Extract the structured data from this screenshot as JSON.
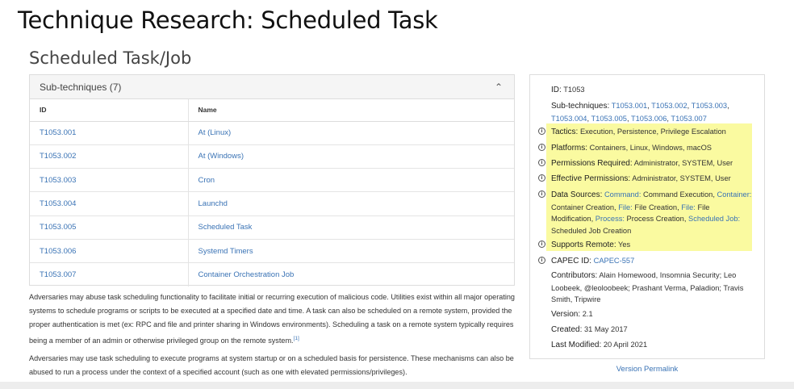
{
  "slide_title": "Technique Research: Scheduled Task",
  "page_heading": "Scheduled Task/Job",
  "subtech": {
    "header": "Sub-techniques (7)",
    "col_id": "ID",
    "col_name": "Name",
    "rows": [
      {
        "id": "T1053.001",
        "name": "At (Linux)"
      },
      {
        "id": "T1053.002",
        "name": "At (Windows)"
      },
      {
        "id": "T1053.003",
        "name": "Cron"
      },
      {
        "id": "T1053.004",
        "name": "Launchd"
      },
      {
        "id": "T1053.005",
        "name": "Scheduled Task"
      },
      {
        "id": "T1053.006",
        "name": "Systemd Timers"
      },
      {
        "id": "T1053.007",
        "name": "Container Orchestration Job"
      }
    ]
  },
  "description": {
    "p1": "Adversaries may abuse task scheduling functionality to facilitate initial or recurring execution of malicious code. Utilities exist within all major operating systems to schedule programs or scripts to be executed at a specified date and time. A task can also be scheduled on a remote system, provided the proper authentication is met (ex: RPC and file and printer sharing in Windows environments). Scheduling a task on a remote system typically requires being a member of an admin or otherwise privileged group on the remote system.",
    "p1_ref": "[1]",
    "p2": "Adversaries may use task scheduling to execute programs at system startup or on a scheduled basis for persistence. These mechanisms can also be abused to run a process under the context of a specified account (such as one with elevated permissions/privileges)."
  },
  "info": {
    "id_label": "ID:",
    "id_value": "T1053",
    "subtech_label": "Sub-techniques:",
    "subtech_links": [
      "T1053.001",
      "T1053.002",
      "T1053.003",
      "T1053.004",
      "T1053.005",
      "T1053.006",
      "T1053.007"
    ],
    "tactics_label": "Tactics:",
    "tactics_value": "Execution, Persistence, Privilege Escalation",
    "platforms_label": "Platforms:",
    "platforms_value": "Containers, Linux, Windows, macOS",
    "perm_req_label": "Permissions Required:",
    "perm_req_value": "Administrator, SYSTEM, User",
    "eff_perm_label": "Effective Permissions:",
    "eff_perm_value": "Administrator, SYSTEM, User",
    "data_sources_label": "Data Sources:",
    "data_sources": [
      {
        "src": "Command:",
        "val": "Command Execution"
      },
      {
        "src": "Container:",
        "val": "Container Creation"
      },
      {
        "src": "File:",
        "val": "File Creation"
      },
      {
        "src": "File:",
        "val": "File Modification"
      },
      {
        "src": "Process:",
        "val": "Process Creation"
      },
      {
        "src": "Scheduled Job:",
        "val": "Scheduled Job Creation"
      }
    ],
    "supports_remote_label": "Supports Remote:",
    "supports_remote_value": "Yes",
    "capec_label": "CAPEC ID:",
    "capec_value": "CAPEC-557",
    "contributors_label": "Contributors:",
    "contributors_value": "Alain Homewood, Insomnia Security; Leo Loobeek, @leoloobeek; Prashant Verma, Paladion; Travis Smith, Tripwire",
    "version_label": "Version:",
    "version_value": "2.1",
    "created_label": "Created:",
    "created_value": "31 May 2017",
    "modified_label": "Last Modified:",
    "modified_value": "20 April 2021",
    "permalink": "Version Permalink",
    "info_icon_glyph": "i"
  },
  "colors": {
    "link": "#3a73b5",
    "highlight": "#fafaa0"
  }
}
